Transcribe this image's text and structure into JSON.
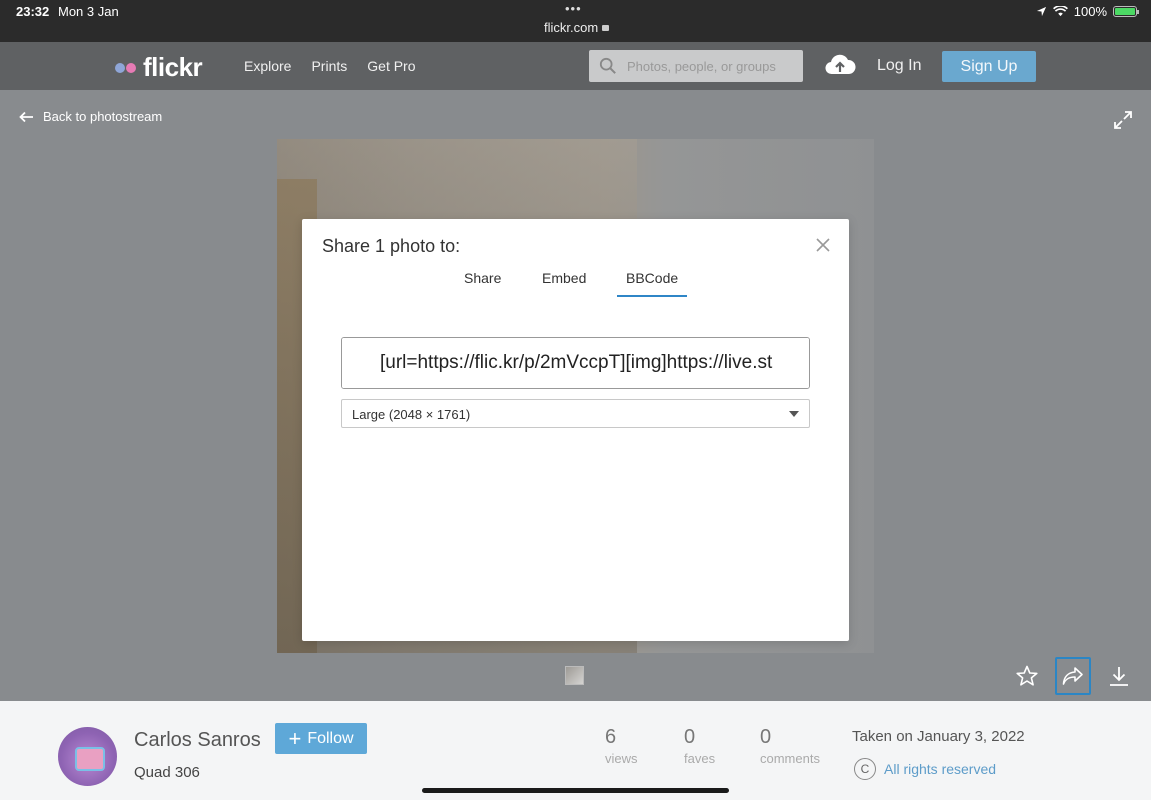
{
  "status_bar": {
    "time": "23:32",
    "date": "Mon 3 Jan",
    "url": "flickr.com",
    "battery": "100%",
    "battery_level": 1.0
  },
  "header": {
    "logo": "flickr",
    "nav": [
      "Explore",
      "Prints",
      "Get Pro"
    ],
    "search_placeholder": "Photos, people, or groups",
    "login": "Log In",
    "signup": "Sign Up"
  },
  "photo_page": {
    "back_label": "Back to photostream"
  },
  "modal": {
    "title": "Share 1 photo to:",
    "tabs": [
      {
        "label": "Share",
        "active": false
      },
      {
        "label": "Embed",
        "active": false
      },
      {
        "label": "BBCode",
        "active": true
      }
    ],
    "code_value": "[url=https://flic.kr/p/2mVccpT][img]https://live.st",
    "size_option": "Large (2048 × 1761)"
  },
  "info": {
    "author": "Carlos Sanros",
    "group": "Quad 306",
    "follow_label": "Follow",
    "stats": [
      {
        "value": "6",
        "label": "views"
      },
      {
        "value": "0",
        "label": "faves"
      },
      {
        "value": "0",
        "label": "comments"
      }
    ],
    "taken": "Taken on January 3, 2022",
    "rights": "All rights reserved",
    "cc_symbol": "C"
  },
  "colors": {
    "accent": "#2f86c7",
    "signup": "#6aa8cf",
    "follow": "#5ea8d8",
    "logo_blue": "#8fa6d8",
    "logo_pink": "#e77bb5"
  }
}
